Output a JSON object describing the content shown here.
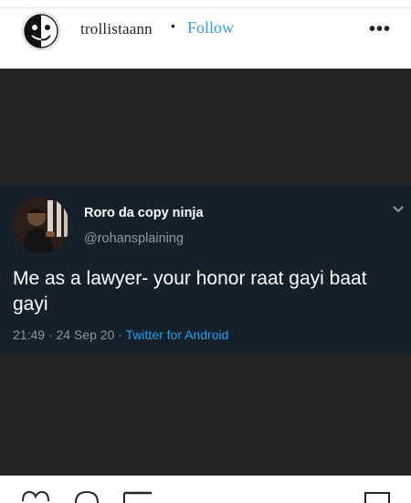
{
  "header": {
    "username": "trollistaann",
    "separator": "•",
    "follow_label": "Follow",
    "more_label": "•••"
  },
  "tweet": {
    "display_name": "Roro da copy ninja",
    "handle": "@rohansplaining",
    "text": "Me as a lawyer- your honor raat gayi baat gayi",
    "time": "21:49",
    "sep": " · ",
    "date": "24 Sep 20",
    "source": "Twitter for Android"
  },
  "colors": {
    "follow": "#3897f0",
    "post_background": "#222325",
    "tweet_background": "#15202b",
    "tweet_source": "#1da1f2",
    "tweet_muted": "#8899a6"
  },
  "icons": [
    "troll-face-icon",
    "chevron-down-icon",
    "heart-icon",
    "comment-icon",
    "share-icon",
    "bookmark-icon"
  ]
}
